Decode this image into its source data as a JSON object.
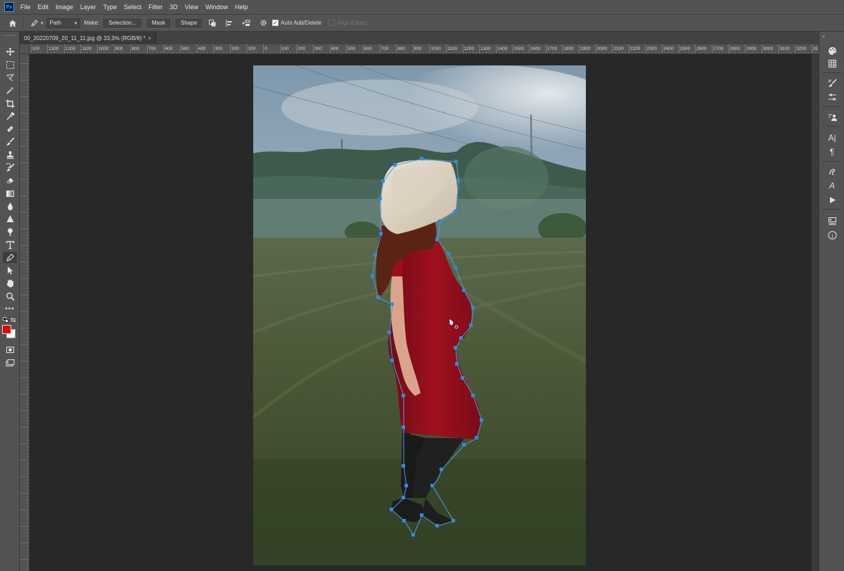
{
  "app": {
    "logo_text": "Ps"
  },
  "menu": [
    "File",
    "Edit",
    "Image",
    "Layer",
    "Type",
    "Select",
    "Filter",
    "3D",
    "View",
    "Window",
    "Help"
  ],
  "options": {
    "mode_value": "Path",
    "make_label": "Make:",
    "selection_button": "Selection...",
    "mask_button": "Mask",
    "shape_button": "Shape",
    "auto_add_delete_label": "Auto Add/Delete",
    "auto_add_delete_checked": true,
    "align_edges_label": "Align Edges",
    "align_edges_checked": false
  },
  "document": {
    "tab_title": "00_20220709_20_11_11.jpg @ 33,3% (RGB/8) *",
    "close_glyph": "×"
  },
  "ruler": {
    "top_labels": [
      "100",
      "1300",
      "1200",
      "1100",
      "1000",
      "900",
      "800",
      "700",
      "600",
      "500",
      "400",
      "300",
      "200",
      "100",
      "0",
      "100",
      "200",
      "300",
      "400",
      "500",
      "600",
      "700",
      "800",
      "900",
      "1000",
      "1100",
      "1200",
      "1300",
      "1400",
      "1500",
      "1600",
      "1700",
      "1800",
      "1900",
      "2000",
      "2100",
      "2200",
      "2300",
      "2400",
      "2500",
      "2600",
      "2700",
      "2800",
      "2900",
      "3000",
      "3100",
      "3200",
      "33"
    ]
  },
  "colors": {
    "foreground": "#e60000",
    "background": "#ffffff",
    "path_stroke": "#4a9fe6",
    "anchor": "#2f8ae6"
  },
  "left_tools": [
    "move-tool",
    "marquee-tool",
    "lasso-tool",
    "magic-wand-tool",
    "crop-tool",
    "eyedropper-tool",
    "spot-healing-tool",
    "brush-tool",
    "clone-stamp-tool",
    "history-brush-tool",
    "eraser-tool",
    "gradient-tool",
    "blur-tool",
    "dodge-tool",
    "pen-tool",
    "type-tool",
    "path-selection-tool",
    "custom-shape-tool",
    "hand-tool",
    "zoom-tool",
    "more-tools"
  ],
  "right_panel_icons": [
    "color-panel-icon",
    "swatches-panel-icon",
    "brushes-panel-icon",
    "adjustments-panel-icon",
    "properties-panel-icon",
    "character-panel-icon",
    "paragraph-panel-icon",
    "glyphs-panel-icon",
    "character-styles-panel-icon",
    "actions-panel-icon",
    "layers-panel-icon",
    "info-panel-icon"
  ],
  "right_panel_labels": {
    "character": "A|",
    "paragraph": "¶",
    "glyphs": "A",
    "info": "i"
  }
}
